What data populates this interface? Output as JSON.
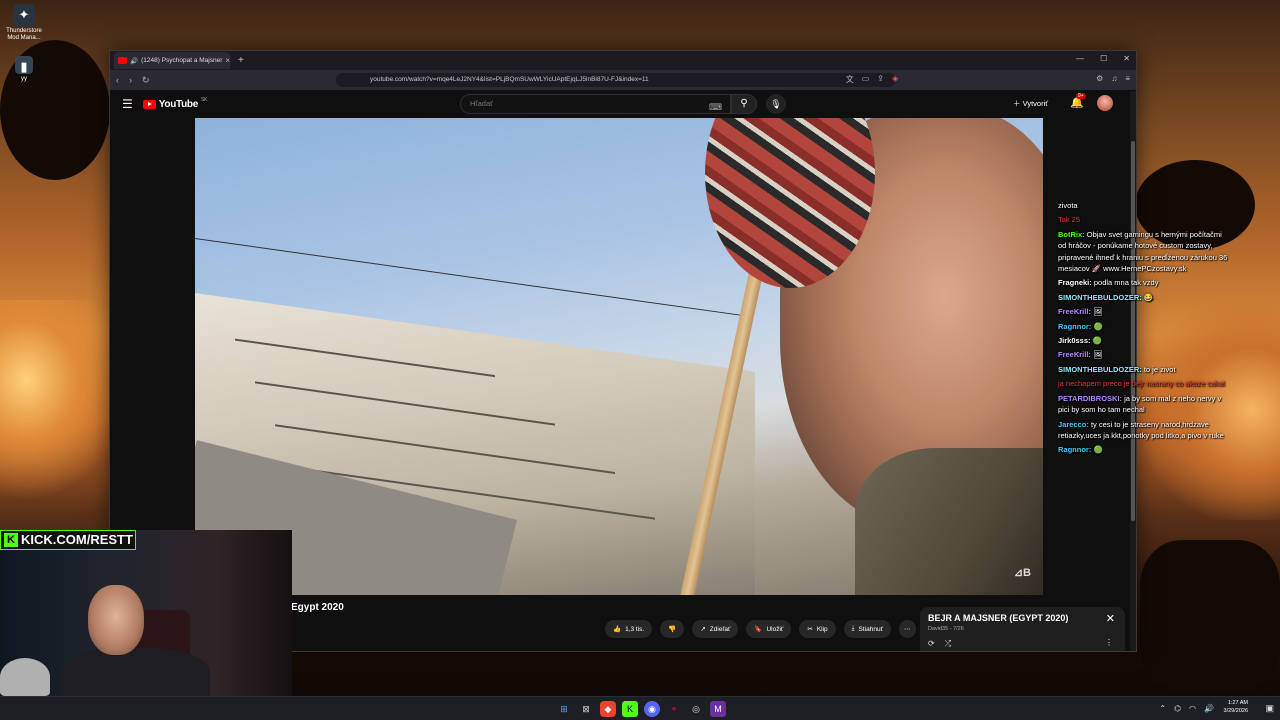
{
  "desktop": {
    "icons": [
      {
        "label": "Thunderstore Mod Mana...",
        "icon": "thunderstore-icon"
      },
      {
        "label": "yy",
        "icon": "folder-icon"
      }
    ]
  },
  "browser": {
    "tab_title": "(1248) Psychopat a Majsner",
    "url": "youtube.com/watch?v=mqe4LeJ2NY4&list=PLjBQmSUwWLYicUAptEjqLJ5lnBi87U-FJ&index=11"
  },
  "youtube": {
    "logo_text": "YouTube",
    "region": "SK",
    "search_placeholder": "Hľadať",
    "create_label": "Vytvoriť",
    "notification_count": "9+"
  },
  "video": {
    "title": "Egypt 2020",
    "actions": {
      "like_count": "1,3 tis.",
      "share": "Zdieľať",
      "save": "Uložiť",
      "clip": "Klip",
      "download": "Stiahnuť"
    }
  },
  "playlist": {
    "title": "BEJR A MAJSNER (EGYPT 2020)",
    "subtitle": "David35 - 7/26"
  },
  "chat": [
    {
      "user": "",
      "text": "zivota",
      "color": "#ffffff"
    },
    {
      "user": "",
      "text": "Tak 25",
      "color": "#e53935"
    },
    {
      "user": "BotRix:",
      "text": "Objav svet gamingu s hernými počítačmi od hráčov - ponúkame hotové custom zostavy, pripravené ihneď k hraniu s predĺženou zárukou 36 mesiacov 🚀 www.HernePCzostavy.sk",
      "color": "#53fc18"
    },
    {
      "user": "Fragneki:",
      "text": "podla mna tak vzdy",
      "color": "#ffffff"
    },
    {
      "user": "SIMONTHEBULDOZER:",
      "text": "😂",
      "color": "#8be9fd"
    },
    {
      "user": "FreeKrill:",
      "text": "🖼",
      "color": "#b388ff"
    },
    {
      "user": "Ragnnor:",
      "text": "🟢",
      "color": "#4fc3f7"
    },
    {
      "user": "Jirk0sss:",
      "text": "🟢",
      "color": "#ffffff"
    },
    {
      "user": "FreeKrill:",
      "text": "🖼",
      "color": "#b388ff"
    },
    {
      "user": "SIMONTHEBULDOZER:",
      "text": "to je zivot",
      "color": "#8be9fd"
    },
    {
      "user": "",
      "text": "ja nechapem preco je bejr nasrany co akoze cakal",
      "color": "#e53935"
    },
    {
      "user": "PETARDIBROSKI:",
      "text": "ja by som mal z neho nervy v pici by som ho tam nechal",
      "color": "#b388ff"
    },
    {
      "user": "Jarecco:",
      "text": "ty cesi to je straseny narod,hrdzave retiazky,uces ja kkt,ponotky pod litko,a pivo v ruke",
      "color": "#4fc3f7"
    },
    {
      "user": "Ragnnor:",
      "text": "🟢",
      "color": "#4fc3f7"
    }
  ],
  "webcam": {
    "banner": "KICK.COM/RESTT"
  },
  "taskbar": {
    "time": "1:27 AM",
    "date": "3/29/2026"
  }
}
